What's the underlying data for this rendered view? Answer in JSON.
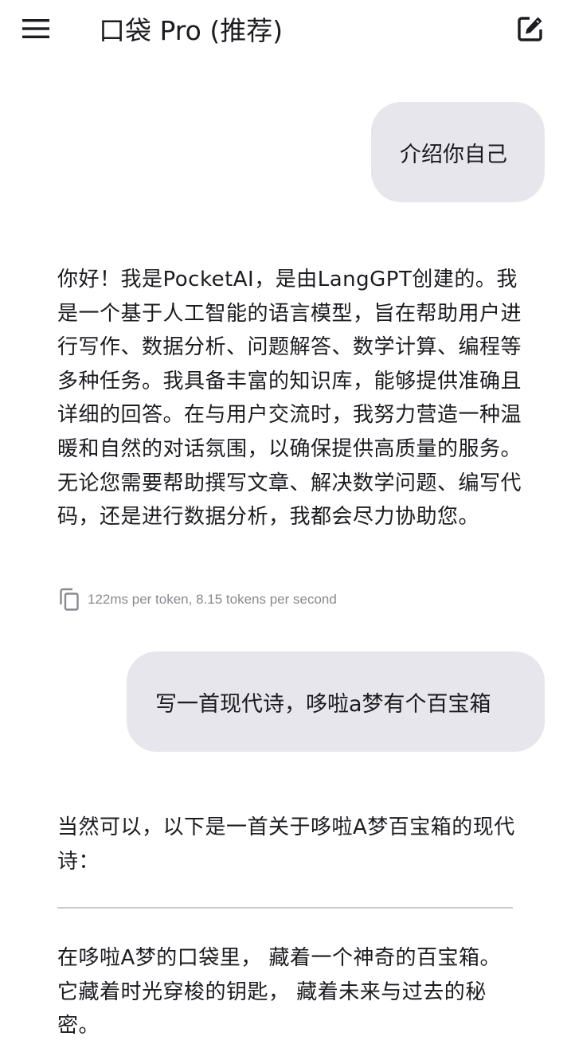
{
  "app_bar": {
    "title": "口袋 Pro (推荐)",
    "menu_icon": "hamburger-menu-icon",
    "edit_icon": "edit-square-icon"
  },
  "messages": [
    {
      "role": "user",
      "text": "介绍你自己"
    },
    {
      "role": "assistant",
      "text": "你好！我是PocketAI，是由LangGPT创建的。我是一个基于人工智能的语言模型，旨在帮助用户进行写作、数据分析、问题解答、数学计算、编程等多种任务。我具备丰富的知识库，能够提供准确且详细的回答。在与用户交流时，我努力营造一种温暖和自然的对话氛围，以确保提供高质量的服务。无论您需要帮助撰写文章、解决数学问题、编写代码，还是进行数据分析，我都会尽力协助您。"
    },
    {
      "role": "user",
      "text": "写一首现代诗，哆啦a梦有个百宝箱"
    },
    {
      "role": "assistant",
      "intro": "当然可以，以下是一首关于哆啦A梦百宝箱的现代诗：",
      "poem": "在哆啦A梦的口袋里， 藏着一个神奇的百宝箱。 它藏着时光穿梭的钥匙， 藏着未来与过去的秘密。"
    }
  ],
  "stats": {
    "copy_icon": "copy-icon",
    "text": "122ms per token, 8.15 tokens per second"
  },
  "colors": {
    "user_bubble": "#e7e6ec",
    "text": "#1c1b1f",
    "stats_text": "#8a898f",
    "divider": "#cfcdd4"
  }
}
